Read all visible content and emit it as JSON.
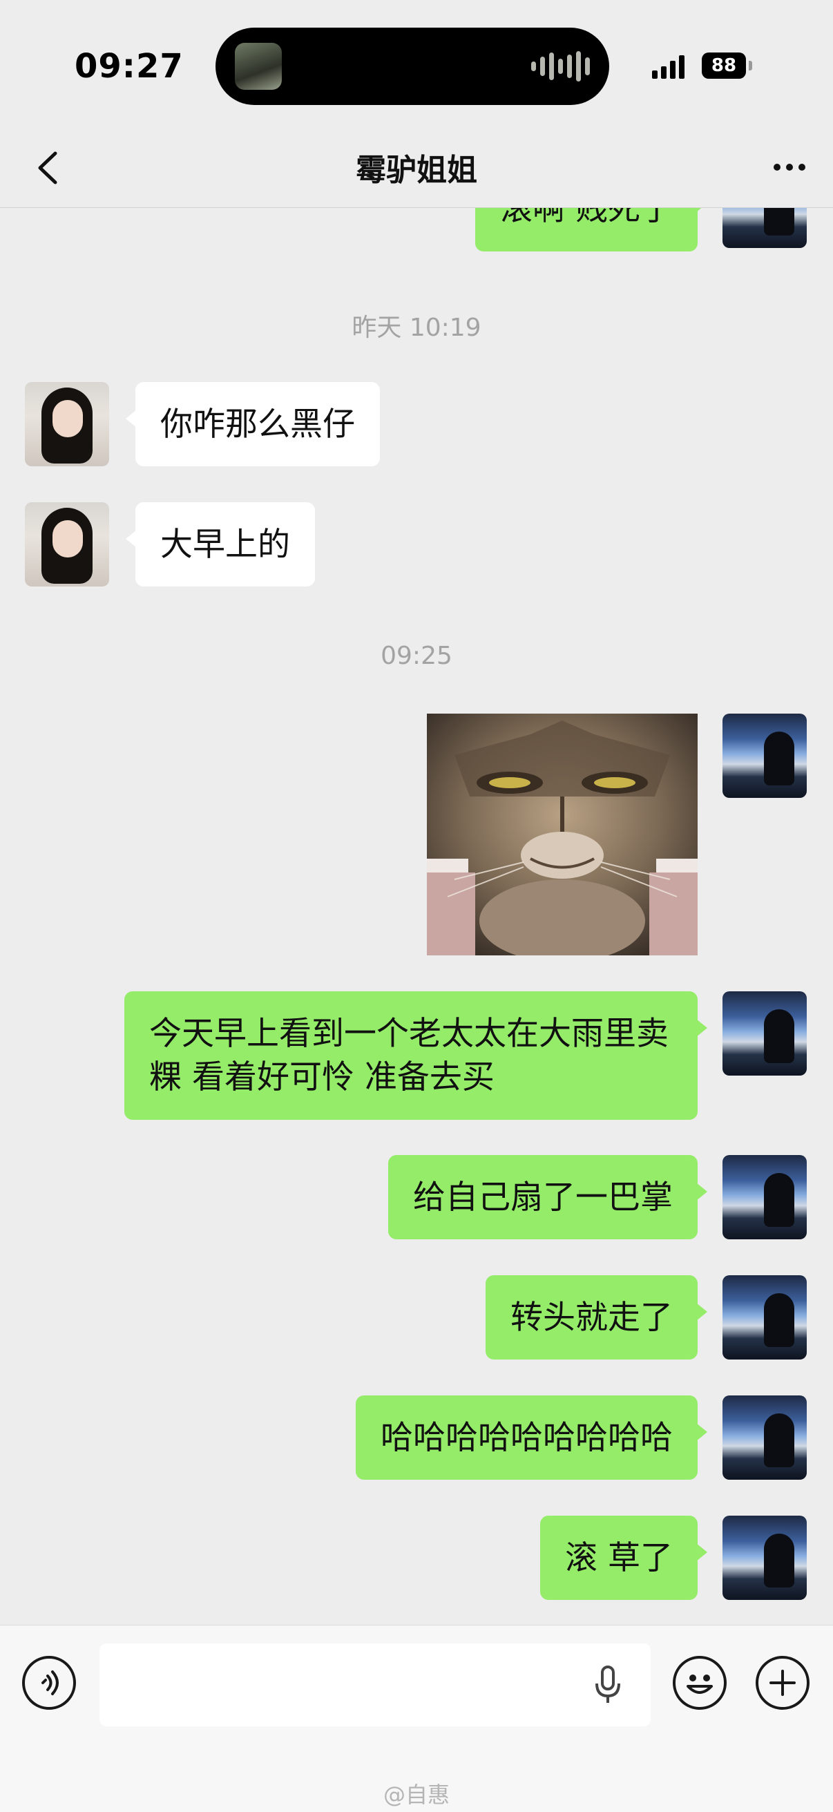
{
  "status": {
    "time": "09:27",
    "battery": "88"
  },
  "nav": {
    "title": "霉驴姐姐"
  },
  "messages": {
    "m0": "滚啊 贱死了",
    "ts1": "昨天 10:19",
    "m1": "你咋那么黑仔",
    "m2": "大早上的",
    "ts2": "09:25",
    "m3": "今天早上看到一个老太太在大雨里卖粿 看着好可怜 准备去买",
    "m4": "给自己扇了一巴掌",
    "m5": "转头就走了",
    "m6": "哈哈哈哈哈哈哈哈哈",
    "m7": "滚 草了"
  },
  "input": {
    "watermark": "@自惠"
  },
  "icons": {
    "back": "chevron-left-icon",
    "more": "more-dots-icon",
    "voice": "voice-icon",
    "mic": "microphone-icon",
    "emoji": "emoji-icon",
    "plus": "plus-icon"
  },
  "colors": {
    "outgoing_bubble": "#95ec69",
    "incoming_bubble": "#ffffff",
    "background": "#ededed"
  }
}
